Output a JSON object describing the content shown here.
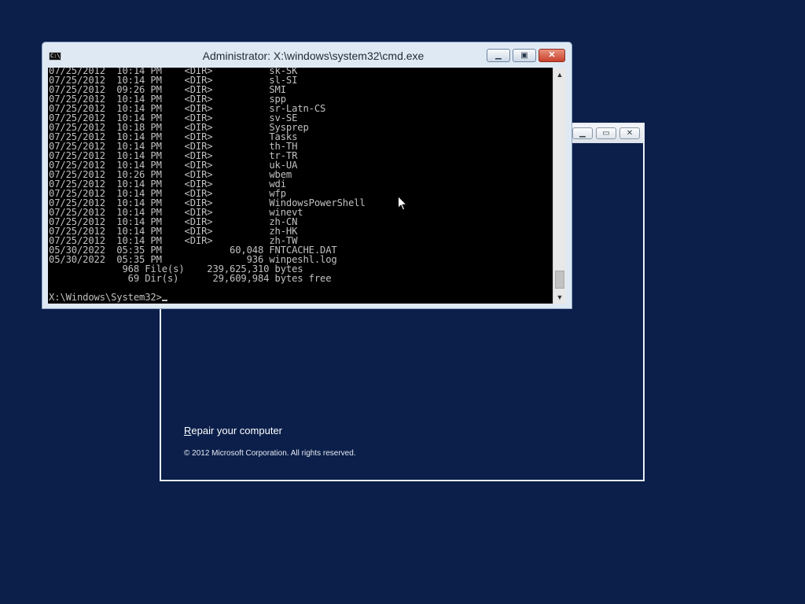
{
  "setup": {
    "repair_first": "R",
    "repair_rest": "epair your computer",
    "copyright": "© 2012 Microsoft Corporation. All rights reserved.",
    "minimize_glyph": "▁",
    "maximize_glyph": "▭",
    "close_glyph": "✕"
  },
  "cmd": {
    "icon_text": "C:\\_",
    "title": "Administrator: X:\\windows\\system32\\cmd.exe",
    "minimize_glyph": "▁",
    "maximize_glyph": "▣",
    "close_glyph": "✕",
    "lines": [
      "07/25/2012  10:14 PM    <DIR>          sk-SK",
      "07/25/2012  10:14 PM    <DIR>          sl-SI",
      "07/25/2012  09:26 PM    <DIR>          SMI",
      "07/25/2012  10:14 PM    <DIR>          spp",
      "07/25/2012  10:14 PM    <DIR>          sr-Latn-CS",
      "07/25/2012  10:14 PM    <DIR>          sv-SE",
      "07/25/2012  10:18 PM    <DIR>          Sysprep",
      "07/25/2012  10:14 PM    <DIR>          Tasks",
      "07/25/2012  10:14 PM    <DIR>          th-TH",
      "07/25/2012  10:14 PM    <DIR>          tr-TR",
      "07/25/2012  10:14 PM    <DIR>          uk-UA",
      "07/25/2012  10:26 PM    <DIR>          wbem",
      "07/25/2012  10:14 PM    <DIR>          wdi",
      "07/25/2012  10:14 PM    <DIR>          wfp",
      "07/25/2012  10:14 PM    <DIR>          WindowsPowerShell",
      "07/25/2012  10:14 PM    <DIR>          winevt",
      "07/25/2012  10:14 PM    <DIR>          zh-CN",
      "07/25/2012  10:14 PM    <DIR>          zh-HK",
      "07/25/2012  10:14 PM    <DIR>          zh-TW",
      "05/30/2022  05:35 PM            60,048 FNTCACHE.DAT",
      "05/30/2022  05:35 PM               936 winpeshl.log",
      "             968 File(s)    239,625,310 bytes",
      "              69 Dir(s)      29,609,984 bytes free",
      ""
    ],
    "prompt": "X:\\Windows\\System32>",
    "scroll_up_glyph": "▲",
    "scroll_down_glyph": "▼"
  }
}
